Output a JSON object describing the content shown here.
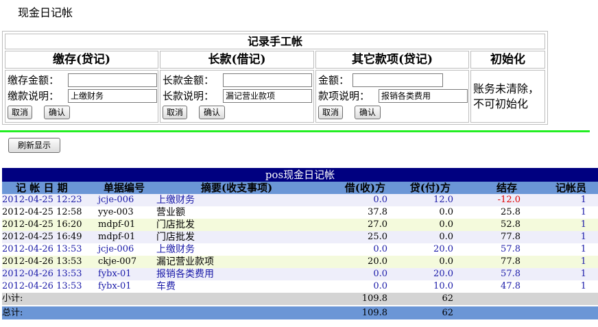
{
  "page_title": "现金日记帐",
  "entry": {
    "title": "记录手工帐",
    "deposit": {
      "header": "缴存(贷记)",
      "amount_label": "缴存金额：",
      "amount_value": "",
      "desc_label": "缴款说明：",
      "desc_value": "上缴财务",
      "cancel": "取消",
      "confirm": "确认"
    },
    "longcash": {
      "header": "长款(借记)",
      "amount_label": "长款金额：",
      "amount_value": "",
      "desc_label": "长款说明：",
      "desc_value": "漏记营业款项",
      "cancel": "取消",
      "confirm": "确认"
    },
    "other": {
      "header": "其它款项(贷记)",
      "amount_label": "金额：",
      "amount_value": "",
      "desc_label": "款项说明：",
      "desc_value": "报销各类费用",
      "cancel": "取消",
      "confirm": "确认"
    },
    "init": {
      "header": "初始化",
      "note_line1": "账务未清除，",
      "note_line2": "不可初始化"
    }
  },
  "refresh_label": "刷新显示",
  "ledger": {
    "title": "pos现金日记帐",
    "columns": {
      "date": "记 帐 日 期",
      "doc_no": "单据编号",
      "summary": "摘要(收支事项)",
      "debit": "借(收)方",
      "credit": "贷(付)方",
      "balance": "结存",
      "clerk": "记帐员"
    },
    "rows": [
      {
        "date": "2012-04-25 12:23",
        "doc_no": "jcje-006",
        "summary": "上缴财务",
        "debit": "0.0",
        "credit": "12.0",
        "balance": "-12.0",
        "clerk": "1"
      },
      {
        "date": "2012-04-25 12:58",
        "doc_no": "yye-003",
        "summary": "营业额",
        "debit": "37.8",
        "credit": "0.0",
        "balance": "25.8",
        "clerk": "1"
      },
      {
        "date": "2012-04-25 16:20",
        "doc_no": "mdpf-01",
        "summary": "门店批发",
        "debit": "27.0",
        "credit": "0.0",
        "balance": "52.8",
        "clerk": "1"
      },
      {
        "date": "2012-04-25 16:49",
        "doc_no": "mdpf-01",
        "summary": "门店批发",
        "debit": "25.0",
        "credit": "0.0",
        "balance": "77.8",
        "clerk": "1"
      },
      {
        "date": "2012-04-26 13:53",
        "doc_no": "jcje-006",
        "summary": "上缴财务",
        "debit": "0.0",
        "credit": "20.0",
        "balance": "57.8",
        "clerk": "1"
      },
      {
        "date": "2012-04-26 13:53",
        "doc_no": "ckje-007",
        "summary": "漏记营业款项",
        "debit": "20.0",
        "credit": "0.0",
        "balance": "77.8",
        "clerk": "1"
      },
      {
        "date": "2012-04-26 13:53",
        "doc_no": "fybx-01",
        "summary": "报销各类费用",
        "debit": "0.0",
        "credit": "20.0",
        "balance": "57.8",
        "clerk": "1"
      },
      {
        "date": "2012-04-26 13:53",
        "doc_no": "fybx-01",
        "summary": "车费",
        "debit": "0.0",
        "credit": "10.0",
        "balance": "47.8",
        "clerk": "1"
      }
    ],
    "subtotal": {
      "label": "小计:",
      "debit": "109.8",
      "credit": "62"
    },
    "total": {
      "label": "总计:",
      "debit": "109.8",
      "credit": "62"
    }
  },
  "colors": {
    "ledger_title_bg": "#000080",
    "header_bg": "#6b96d6",
    "separator": "#22ee22",
    "negative": "#e00000"
  }
}
